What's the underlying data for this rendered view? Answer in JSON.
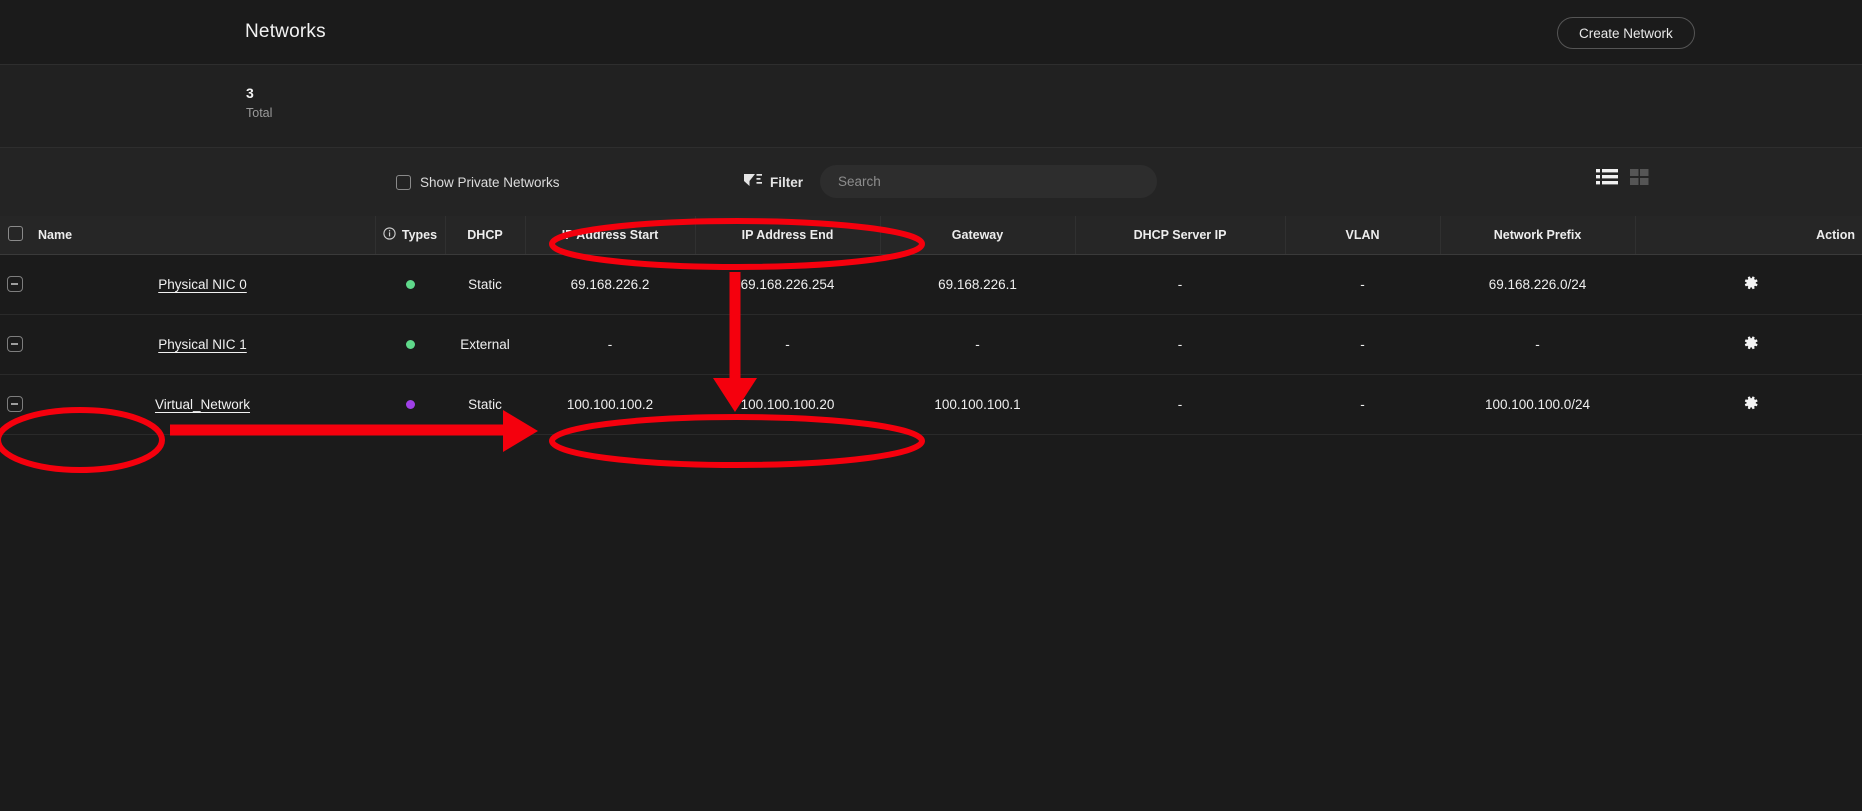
{
  "header": {
    "title": "Networks",
    "create_button": "Create Network"
  },
  "summary": {
    "count": "3",
    "label": "Total"
  },
  "toolbar": {
    "show_private_label": "Show Private Networks",
    "show_private_checked": false,
    "filter_label": "Filter",
    "search_placeholder": "Search",
    "search_value": "",
    "view_list_active": true,
    "view_grid_active": false
  },
  "table": {
    "columns": [
      "Name",
      "Types",
      "DHCP",
      "IP Address Start",
      "IP Address End",
      "Gateway",
      "DHCP Server IP",
      "VLAN",
      "Network Prefix",
      "Action"
    ],
    "rows": [
      {
        "name": "Physical NIC 0",
        "type_color": "#5fd98a",
        "dhcp": "Static",
        "ip_start": "69.168.226.2",
        "ip_end": "69.168.226.254",
        "gateway": "69.168.226.1",
        "dhcp_server_ip": "-",
        "vlan": "-",
        "prefix": "69.168.226.0/24"
      },
      {
        "name": "Physical NIC 1",
        "type_color": "#5fd98a",
        "dhcp": "External",
        "ip_start": "-",
        "ip_end": "-",
        "gateway": "-",
        "dhcp_server_ip": "-",
        "vlan": "-",
        "prefix": "-"
      },
      {
        "name": "Virtual_Network",
        "type_color": "#a040e8",
        "dhcp": "Static",
        "ip_start": "100.100.100.2",
        "ip_end": "100.100.100.20",
        "gateway": "100.100.100.1",
        "dhcp_server_ip": "-",
        "vlan": "-",
        "prefix": "100.100.100.0/24"
      }
    ]
  },
  "annotations": {
    "color": "#f5000d",
    "items": [
      "ellipse-around-ip-address-columns-header",
      "down-arrow-to-virtual-network-ip-range",
      "ellipse-around-virtual-network-name",
      "right-arrow-from-name-to-ip-range",
      "ellipse-around-virtual-network-ip-range"
    ]
  }
}
